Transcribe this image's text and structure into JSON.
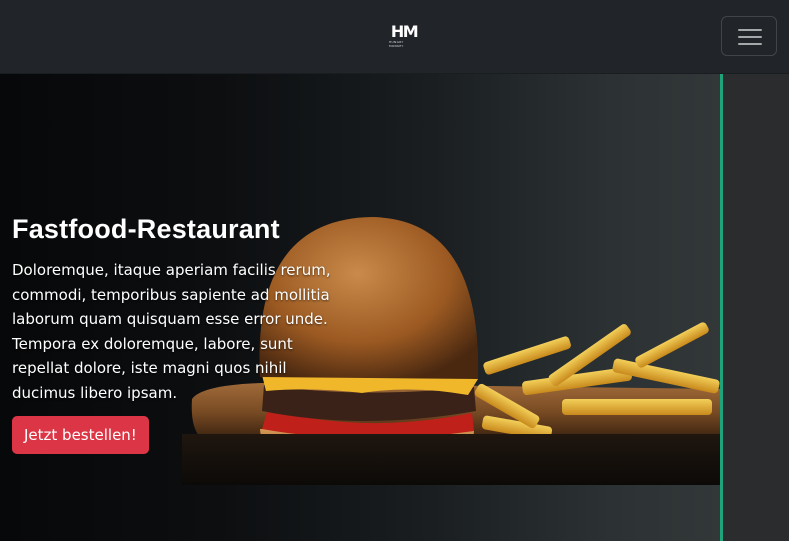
{
  "navbar": {
    "logo_text": "HM",
    "logo_tagline": "HUNGRY MONKEY",
    "menu_icon": "hamburger-menu-icon"
  },
  "hero": {
    "title": "Fastfood-Restaurant",
    "text": "Doloremque, itaque aperiam facilis rerum, commodi, temporibus sapiente ad mollitia laborum quam quisquam esse error unde. Tempora ex doloremque, labore, sunt repellat dolore, iste magni quos nihil ducimus libero ipsam.",
    "button_label": "Jetzt bestellen!",
    "image": "burger-and-fries-image"
  },
  "colors": {
    "navbar": "#212529",
    "button": "#dc3545",
    "accent_border": "#1fa37a"
  }
}
